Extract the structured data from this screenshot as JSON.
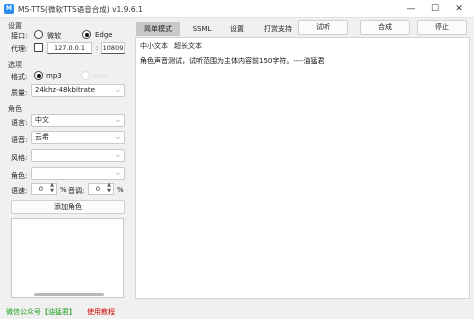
{
  "window": {
    "title": "MS-TTS(微软TTS语音合成) v1.9.6.1",
    "icon": "app-icon",
    "minimize": "—",
    "maximize": "☐",
    "close": "✕"
  },
  "settings": {
    "section": "设置",
    "interface_label": "接口:",
    "interface_options": [
      "微软",
      "Edge"
    ],
    "interface_selected": "Edge",
    "proxy_label": "代理:",
    "proxy_enabled": false,
    "proxy_host": "127.0.0.1",
    "proxy_sep": ":",
    "proxy_port": "10809"
  },
  "options": {
    "section": "选项",
    "format_label": "格式:",
    "format_options": [
      "mp3",
      "wav"
    ],
    "format_selected": "mp3",
    "quality_label": "质量:",
    "quality_value": "24khz-48kbitrate"
  },
  "role": {
    "section": "角色",
    "language_label": "语言:",
    "language_value": "中文",
    "voice_label": "语音:",
    "voice_value": "云希",
    "style_label": "风格:",
    "style_value": "",
    "role_label": "角色:",
    "role_value": "",
    "speed_label": "语速:",
    "speed_value": "0",
    "percent": "%",
    "pitch_label": "音调:",
    "pitch_value": "0",
    "add_role_button": "添加角色",
    "role_list": []
  },
  "tabs": [
    "简单模式",
    "SSML",
    "设置",
    "打赏支持"
  ],
  "active_tab": "简单模式",
  "actions": {
    "preview": "试听",
    "synthesize": "合成",
    "stop": "停止"
  },
  "editor": {
    "subtabs": [
      "中小文本",
      "超长文本"
    ],
    "active_subtab": "中小文本",
    "text": "角色声音测试，试听范围为主体内容前150字符。----油猛君"
  },
  "footer": {
    "wechat": "微信公众号【油猛君】",
    "tutorial": "使用教程",
    "wechat_color": "#1a9c1a",
    "tutorial_color": "#d00000"
  },
  "icons": {
    "chevron": "chevron-down-icon",
    "stepper": "stepper-arrows-icon"
  }
}
